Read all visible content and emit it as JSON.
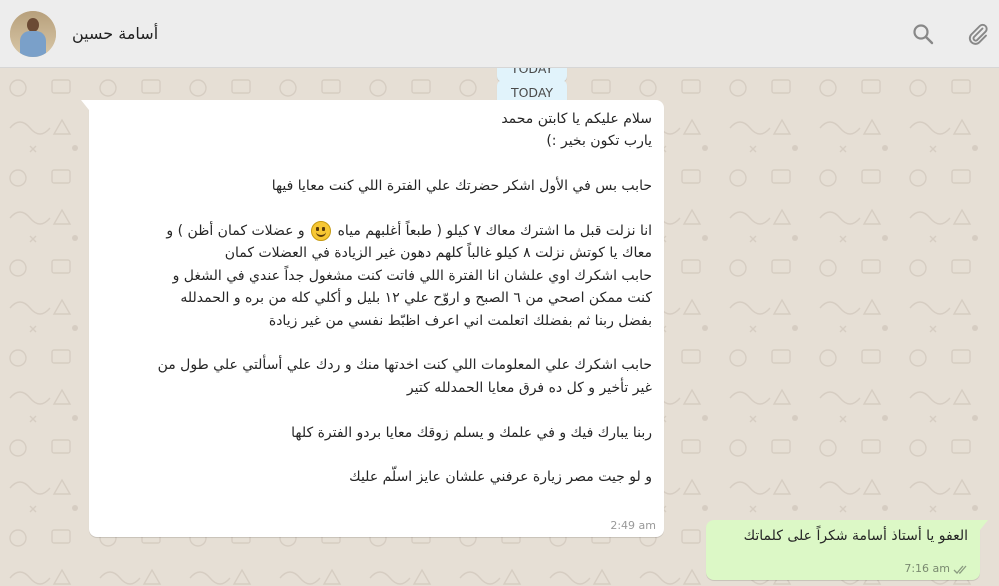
{
  "header": {
    "contact_name": "أسامة حسين",
    "avatar_icon": "contact-avatar",
    "search_icon": "search-icon",
    "attach_icon": "paperclip-icon"
  },
  "chat": {
    "day_labels": [
      "TODAY",
      "TODAY"
    ],
    "incoming": {
      "lines": [
        "سلام عليكم يا كابتن محمد",
        "يارب تكون بخير :)",
        "",
        "حابب بس في الأول اشكر حضرتك علي الفترة اللي كنت معايا فيها",
        "",
        "انا نزلت قبل ما اشترك معاك ٧ كيلو ( طبعاً أغلبهم مياه",
        "و عضلات كمان أظن ) و",
        "معاك يا كوتش نزلت ٨ كيلو غالباً كلهم دهون غير الزيادة في العضلات كمان",
        "حابب اشكرك اوي علشان انا الفترة اللي فاتت كنت مشغول جداً عندي في الشغل و",
        "كنت ممكن اصحي من ٦ الصبح و اروّح علي ١٢ بليل و أكلي كله من بره و الحمدلله",
        "بفضل ربنا ثم بفضلك اتعلمت اني اعرف اظبّط نفسي من غير زيادة",
        "",
        "حابب اشكرك علي المعلومات اللي كنت اخدتها منك و ردك علي أسألتي علي طول من",
        "غير تأخير و كل ده فرق معايا الحمدلله كتير",
        "",
        "ربنا يبارك فيك و في علمك و يسلم زوقك معايا بردو الفترة كلها",
        "",
        "و لو جيت مصر زيارة عرفني علشان عايز اسلّم عليك"
      ],
      "time": "2:49 am"
    },
    "outgoing": {
      "text": "العفو يا أستاذ أسامة شكراً على كلماتك",
      "time": "7:16 am",
      "status_icon": "double-check-icon"
    },
    "colors": {
      "incoming_bubble": "#ffffff",
      "outgoing_bubble": "#dcf8c6",
      "header_bg": "#ededed",
      "chat_bg": "#e6dfd5",
      "day_pill": "#e1f3fb"
    }
  }
}
